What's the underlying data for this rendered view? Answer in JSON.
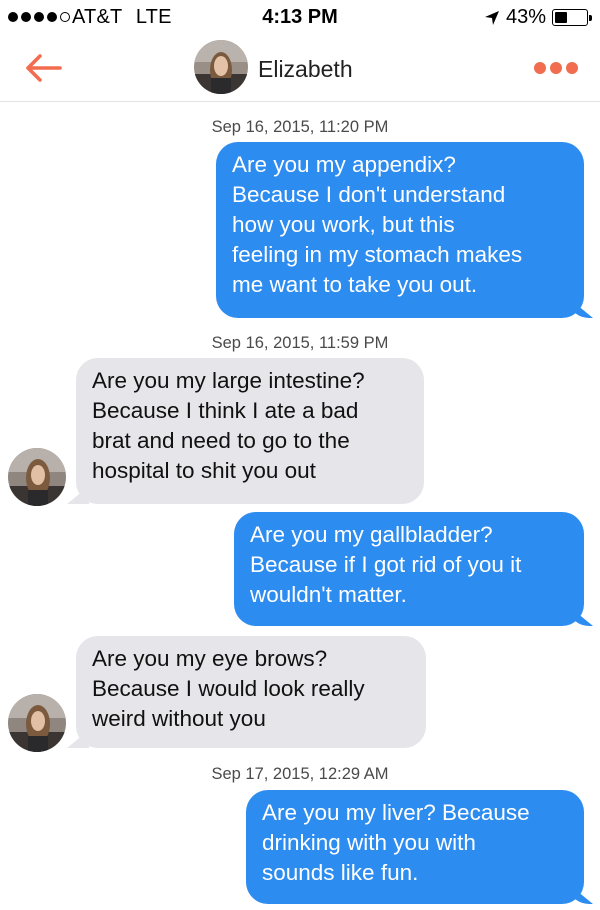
{
  "status_bar": {
    "carrier": "AT&T",
    "network": "LTE",
    "time": "4:13 PM",
    "battery_percent": "43%",
    "battery_level": 0.43,
    "signal_bars_filled": 4,
    "signal_bars_total": 5
  },
  "header": {
    "back_icon": "back-arrow-icon",
    "contact_name": "Elizabeth",
    "more_icon": "more-dots-icon",
    "accent_color": "#f26c4f"
  },
  "messages": [
    {
      "type": "timestamp",
      "text": "Sep 16, 2015, 11:20 PM"
    },
    {
      "type": "sent",
      "lines": [
        "Are you my appendix?",
        "Because I don't understand",
        "how you work, but this",
        "feeling in my stomach makes",
        "me want to take you out."
      ]
    },
    {
      "type": "timestamp",
      "text": "Sep 16, 2015, 11:59 PM"
    },
    {
      "type": "received",
      "lines": [
        "Are you my large intestine?",
        "Because I think I ate a bad",
        "brat and need to go to the",
        "hospital to shit you out"
      ]
    },
    {
      "type": "sent",
      "lines": [
        "Are you my gallbladder?",
        "Because if I got rid of you it",
        "wouldn't matter."
      ]
    },
    {
      "type": "received",
      "lines": [
        "Are you my eye brows?",
        "Because I would look really",
        "weird without you"
      ]
    },
    {
      "type": "timestamp",
      "text": "Sep 17, 2015, 12:29 AM"
    },
    {
      "type": "sent",
      "lines": [
        "Are you my liver? Because",
        "drinking with you with",
        "sounds like fun."
      ]
    }
  ],
  "colors": {
    "sent_bubble": "#2d8cf0",
    "received_bubble": "#e5e5ea"
  }
}
